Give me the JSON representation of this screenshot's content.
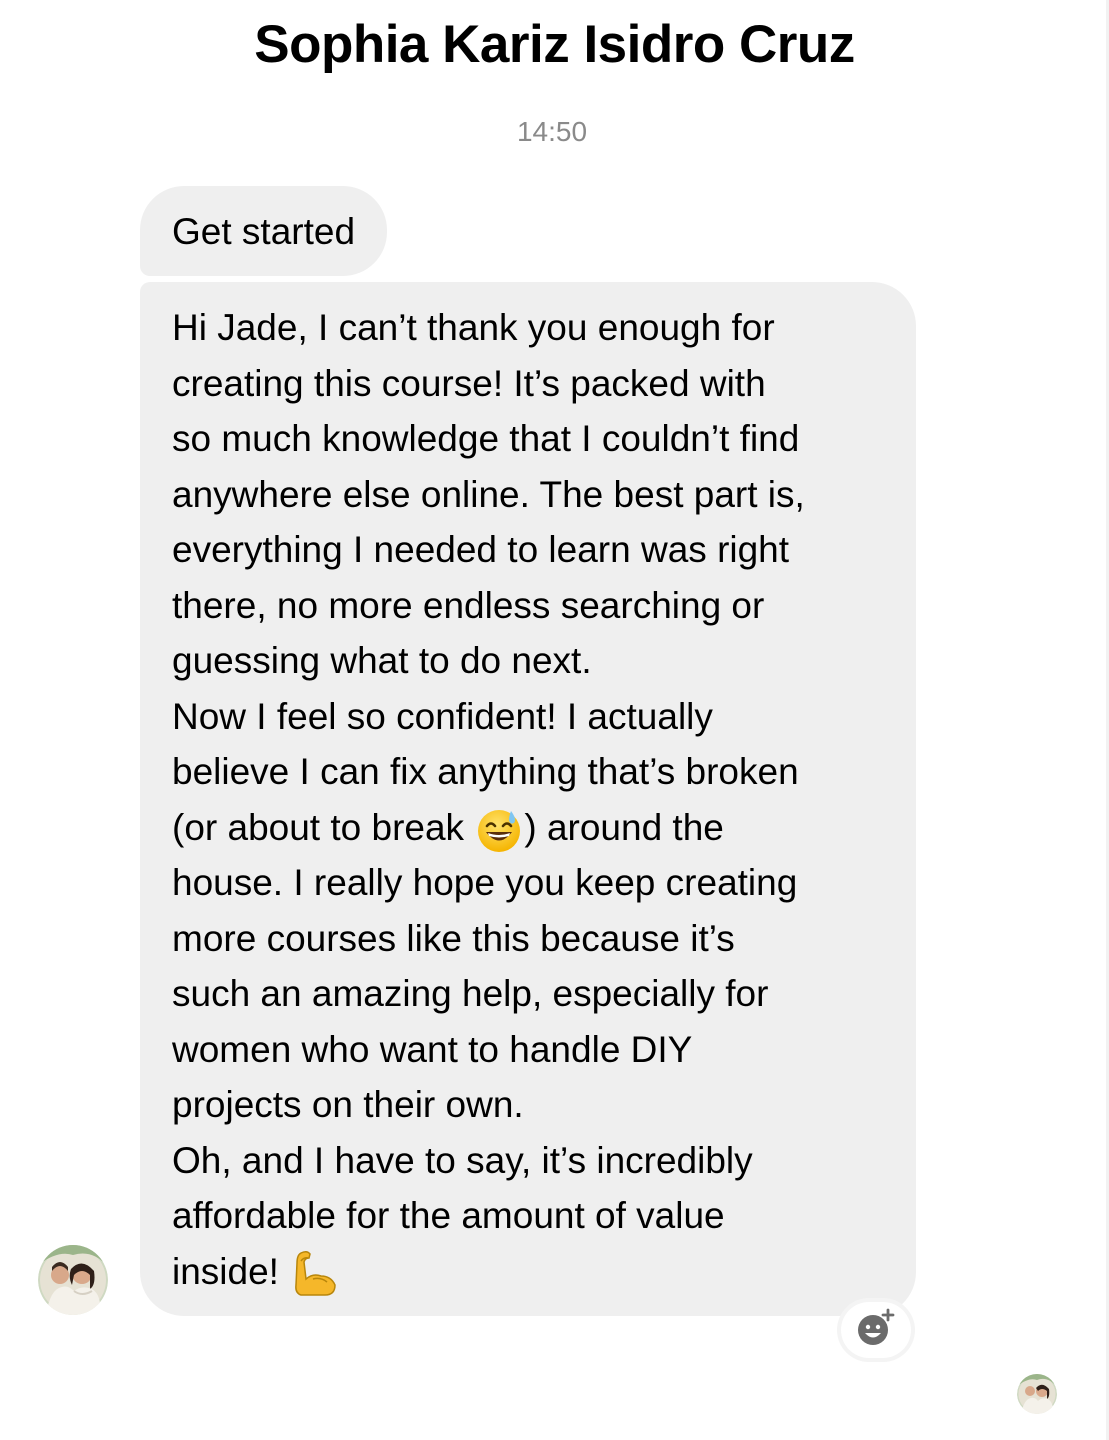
{
  "header": {
    "contact_name": "Sophia Kariz Isidro Cruz"
  },
  "thread": {
    "timestamp": "14:50",
    "messages": [
      {
        "text": "Get started"
      },
      {
        "lines": [
          "Hi Jade, I can’t thank you enough for",
          "creating this course! It’s packed with",
          "so much knowledge that I couldn’t find",
          "anywhere else online. The best part is,",
          "everything I needed to learn was right",
          "there, no more endless searching or",
          "guessing what to do next.",
          "Now I feel so confident! I actually",
          "believe I can fix anything that’s broken",
          "(or about to break",
          ") around the",
          "house. I really hope you keep creating",
          "more courses like this because it’s",
          "such an amazing help, especially for",
          "women who want to handle DIY",
          "projects on their own.",
          "Oh, and I have to say, it’s incredibly",
          "affordable for the amount of value",
          "inside!"
        ],
        "emojis": [
          "grinning-face-with-sweat-emoji",
          "flexed-biceps-emoji"
        ]
      }
    ]
  },
  "icons": {
    "react": "add-reaction-icon",
    "sender_avatar": "avatar",
    "seen_avatar": "read-receipt-avatar"
  },
  "colors": {
    "bubble_background": "#efefef",
    "timestamp_text": "#8a8a8a",
    "react_icon": "#6b6b6b"
  }
}
